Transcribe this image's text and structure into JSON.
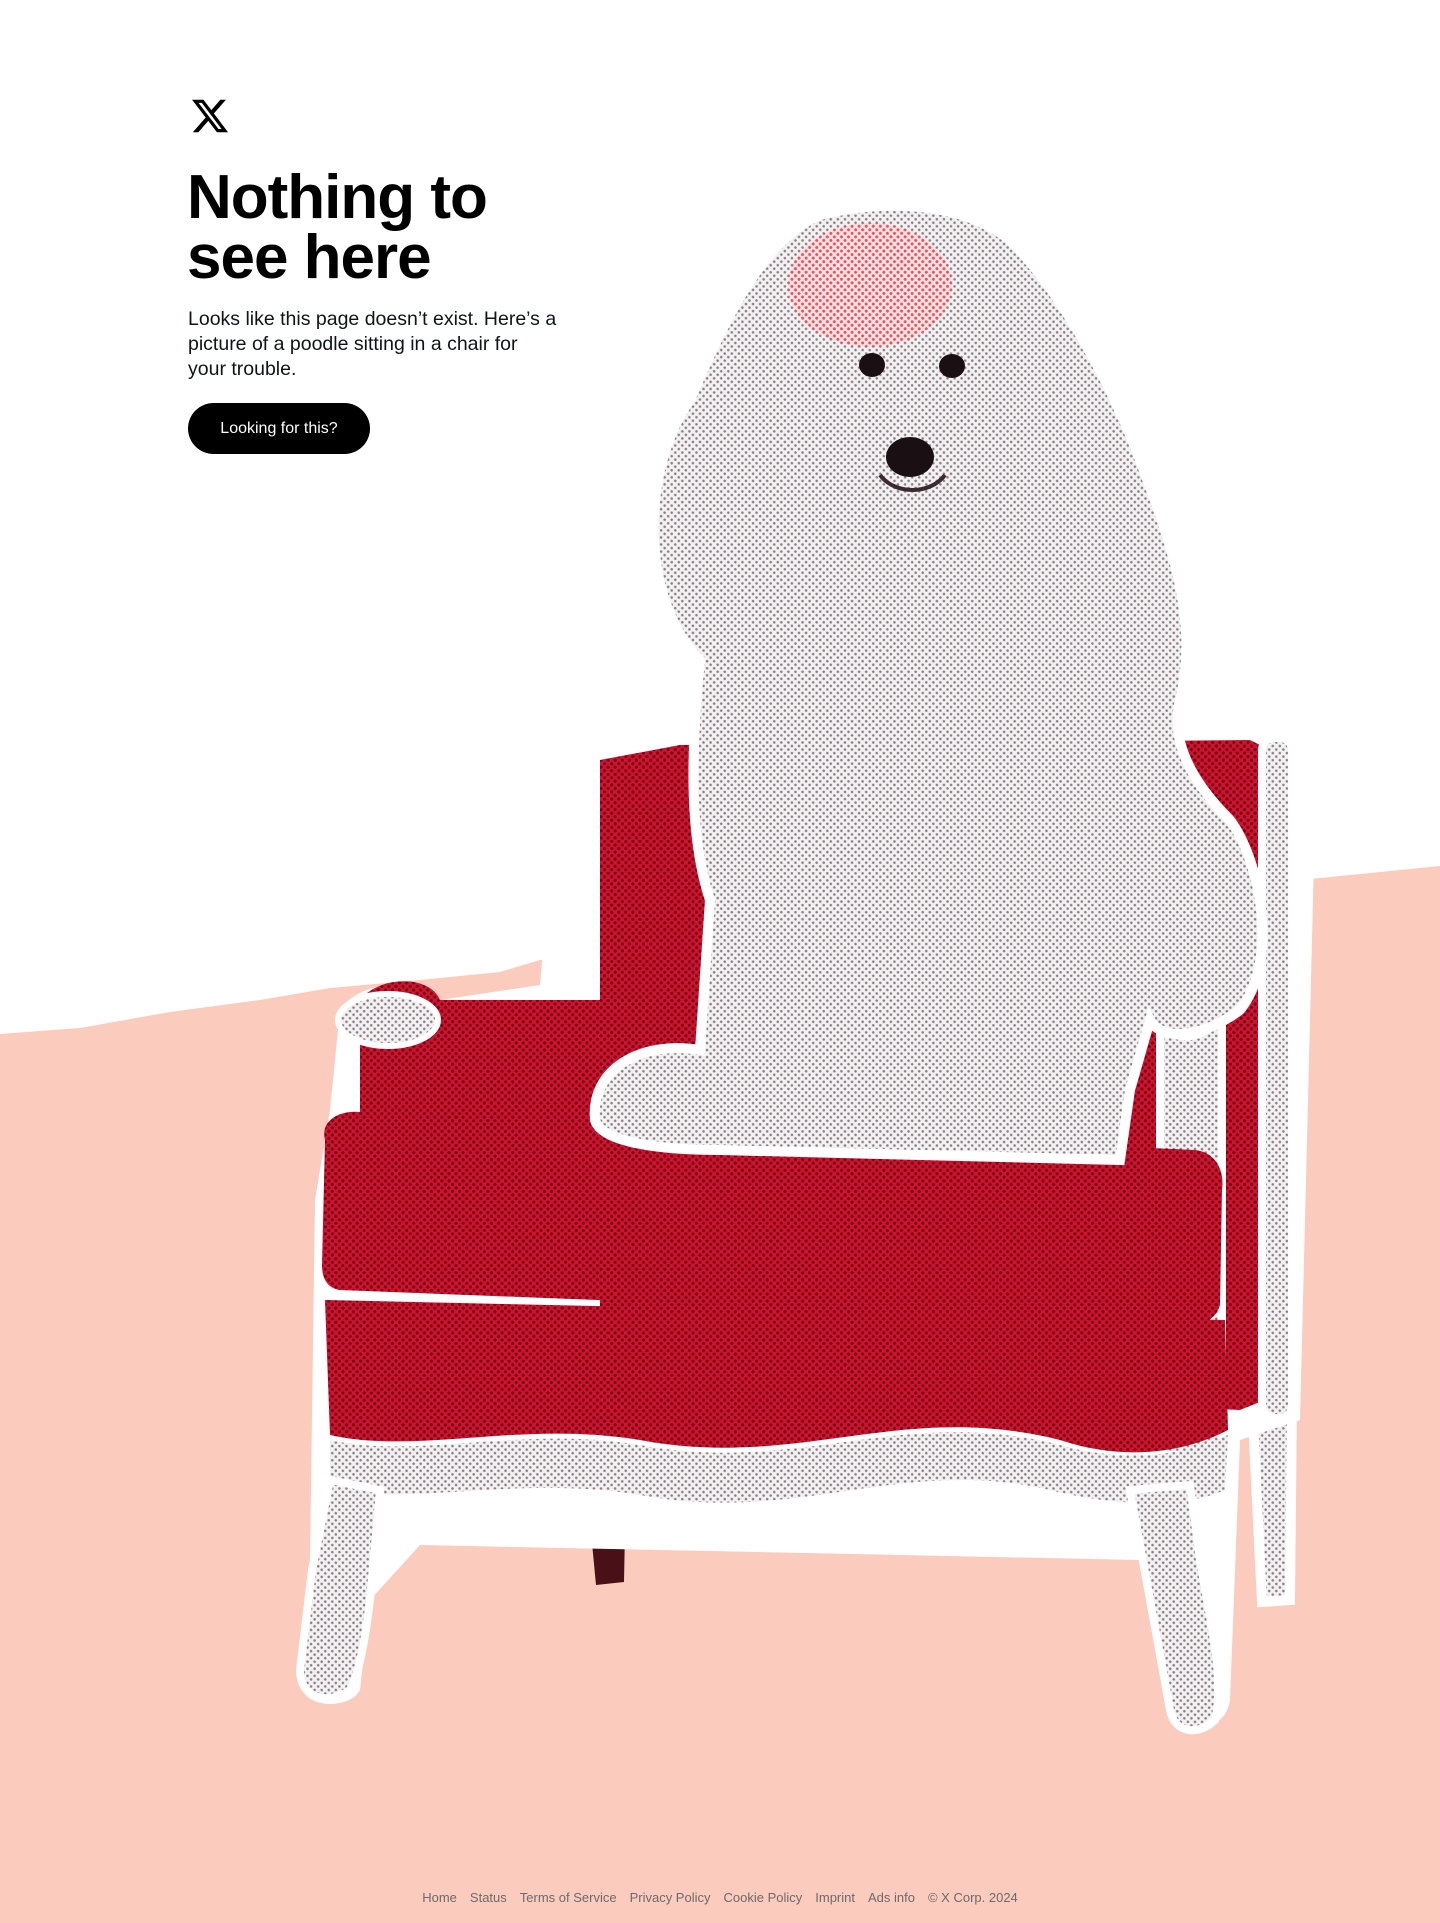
{
  "colors": {
    "background": "#ffffff",
    "floor": "#fbcbbe",
    "chair_red": "#c8102e",
    "text": "#000000",
    "button_bg": "#000000",
    "button_text": "#ffffff",
    "footer_text": "#6b6b6b"
  },
  "brand": {
    "logo_icon": "x-logo-icon"
  },
  "heading": {
    "line1": "Nothing to",
    "line2": "see here"
  },
  "description": "Looks like this page doesn’t exist. Here’s a picture of a poodle sitting in a chair for your trouble.",
  "cta": {
    "label": "Looking for this?"
  },
  "footer": {
    "links": [
      "Home",
      "Status",
      "Terms of Service",
      "Privacy Policy",
      "Cookie Policy",
      "Imprint",
      "Ads info"
    ],
    "copyright": "© X Corp. 2024"
  }
}
